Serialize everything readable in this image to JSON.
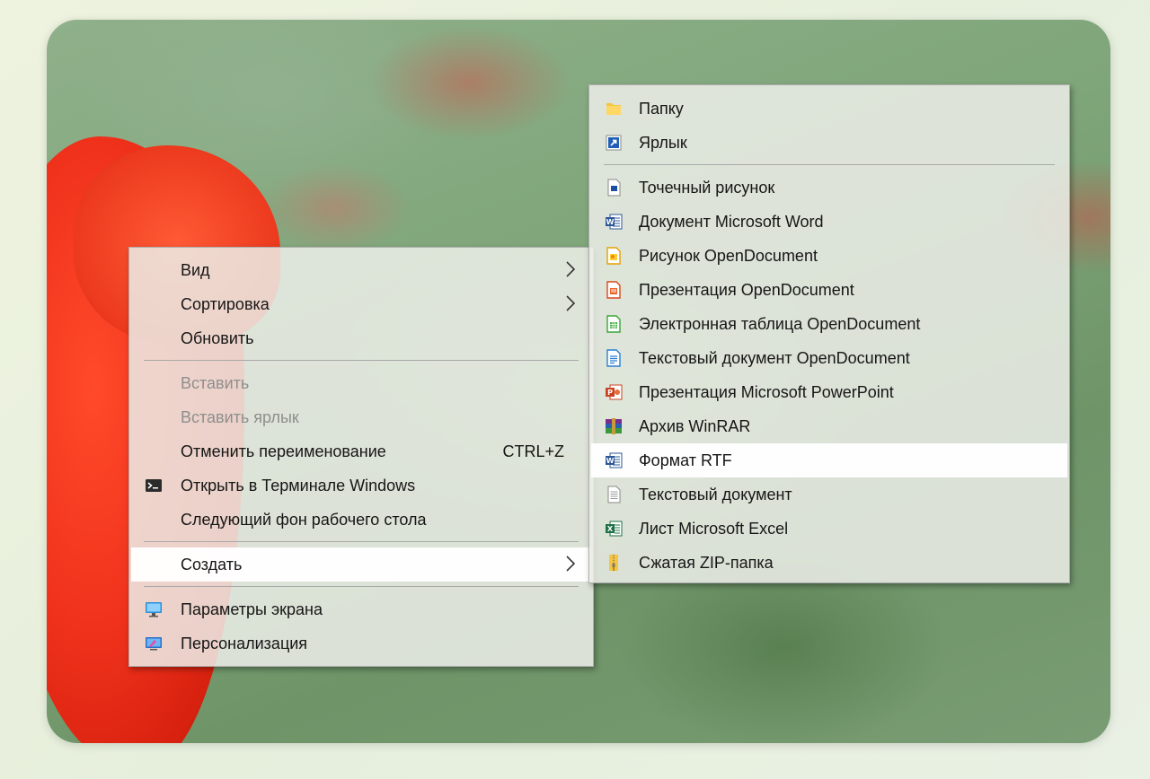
{
  "context_menu": {
    "items": [
      {
        "label": "Вид",
        "icon": "chevron-right-icon"
      },
      {
        "label": "Сортировка",
        "icon": "chevron-right-icon"
      },
      {
        "label": "Обновить"
      },
      {
        "label": "Вставить",
        "disabled": true
      },
      {
        "label": "Вставить ярлык",
        "disabled": true
      },
      {
        "label": "Отменить переименование",
        "shortcut": "CTRL+Z"
      },
      {
        "label": "Открыть в Терминале Windows",
        "icon": "terminal-icon"
      },
      {
        "label": "Следующий фон рабочего стола"
      },
      {
        "label": "Создать",
        "highlighted": true,
        "icon": "chevron-right-icon"
      },
      {
        "label": "Параметры экрана",
        "icon": "display-settings-icon"
      },
      {
        "label": "Персонализация",
        "icon": "personalization-icon"
      }
    ]
  },
  "create_submenu": {
    "items": [
      {
        "label": "Папку",
        "icon": "folder-icon"
      },
      {
        "label": "Ярлык",
        "icon": "shortcut-icon"
      },
      {
        "label": "Точечный рисунок",
        "icon": "bitmap-icon"
      },
      {
        "label": "Документ Microsoft Word",
        "icon": "word-icon"
      },
      {
        "label": "Рисунок OpenDocument",
        "icon": "od-drawing-icon"
      },
      {
        "label": "Презентация OpenDocument",
        "icon": "od-presentation-icon"
      },
      {
        "label": "Электронная таблица OpenDocument",
        "icon": "od-spreadsheet-icon"
      },
      {
        "label": "Текстовый документ OpenDocument",
        "icon": "od-text-icon"
      },
      {
        "label": "Презентация Microsoft PowerPoint",
        "icon": "powerpoint-icon"
      },
      {
        "label": "Архив WinRAR",
        "icon": "winrar-icon"
      },
      {
        "label": "Формат RTF",
        "icon": "rtf-icon",
        "highlighted": true
      },
      {
        "label": "Текстовый документ",
        "icon": "text-document-icon"
      },
      {
        "label": "Лист Microsoft Excel",
        "icon": "excel-icon"
      },
      {
        "label": "Сжатая ZIP-папка",
        "icon": "zip-folder-icon"
      }
    ]
  }
}
